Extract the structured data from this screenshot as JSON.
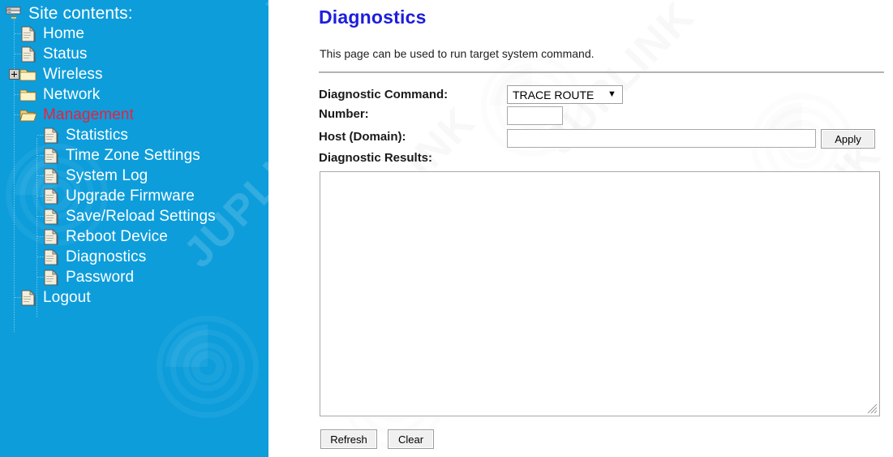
{
  "sidebar": {
    "root_label": "Site contents:",
    "root_icon": "server-icon",
    "background_color": "#0d9ddb",
    "text_color": "#ffffff",
    "active_color": "#ef1e3c",
    "items": [
      {
        "label": "Home",
        "icon": "page-icon",
        "level": 1,
        "type": "page",
        "active": false,
        "expander": false
      },
      {
        "label": "Status",
        "icon": "page-icon",
        "level": 1,
        "type": "page",
        "active": false,
        "expander": false
      },
      {
        "label": "Wireless",
        "icon": "folder-icon",
        "level": 1,
        "type": "folder",
        "active": false,
        "expander": true
      },
      {
        "label": "Network",
        "icon": "folder-icon",
        "level": 1,
        "type": "folder",
        "active": false,
        "expander": false
      },
      {
        "label": "Management",
        "icon": "folder-open-icon",
        "level": 1,
        "type": "folder",
        "active": true,
        "expander": false
      },
      {
        "label": "Statistics",
        "icon": "page-icon",
        "level": 2,
        "type": "page",
        "active": false,
        "expander": false
      },
      {
        "label": "Time Zone Settings",
        "icon": "page-icon",
        "level": 2,
        "type": "page",
        "active": false,
        "expander": false
      },
      {
        "label": "System Log",
        "icon": "page-icon",
        "level": 2,
        "type": "page",
        "active": false,
        "expander": false
      },
      {
        "label": "Upgrade Firmware",
        "icon": "page-icon",
        "level": 2,
        "type": "page",
        "active": false,
        "expander": false
      },
      {
        "label": "Save/Reload Settings",
        "icon": "page-icon",
        "level": 2,
        "type": "page",
        "active": false,
        "expander": false
      },
      {
        "label": "Reboot Device",
        "icon": "page-icon",
        "level": 2,
        "type": "page",
        "active": false,
        "expander": false
      },
      {
        "label": "Diagnostics",
        "icon": "page-icon",
        "level": 2,
        "type": "page",
        "active": false,
        "expander": false
      },
      {
        "label": "Password",
        "icon": "page-icon",
        "level": 2,
        "type": "page",
        "active": false,
        "expander": false
      },
      {
        "label": "Logout",
        "icon": "page-icon",
        "level": 1,
        "type": "page",
        "active": false,
        "expander": false
      }
    ]
  },
  "main": {
    "title": "Diagnostics",
    "title_color": "#1d1ddd",
    "description": "This page can be used to run target system command.",
    "labels": {
      "command": "Diagnostic Command:",
      "number": "Number:",
      "host": "Host (Domain):",
      "results": "Diagnostic Results:"
    },
    "command_select": {
      "selected": "TRACE ROUTE",
      "options": [
        "TRACE ROUTE"
      ],
      "arrow_glyph": "▼"
    },
    "number_input": {
      "value": "",
      "placeholder": ""
    },
    "host_input": {
      "value": "",
      "placeholder": ""
    },
    "results_textarea": {
      "value": "",
      "placeholder": ""
    },
    "buttons": {
      "apply": "Apply",
      "refresh": "Refresh",
      "clear": "Clear"
    }
  },
  "watermark": {
    "text": "JUPLINK"
  }
}
